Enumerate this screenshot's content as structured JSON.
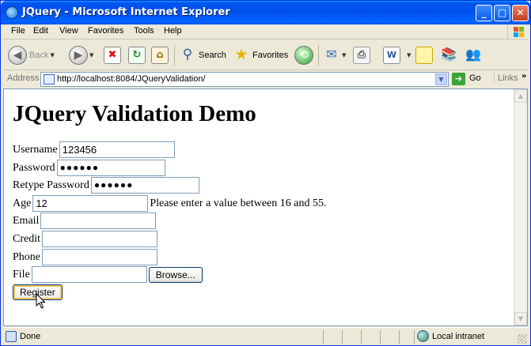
{
  "window": {
    "title": "JQuery - Microsoft Internet Explorer",
    "controls": {
      "minimize": "_",
      "maximize": "□",
      "close": "✕"
    }
  },
  "menu": {
    "items": [
      "File",
      "Edit",
      "View",
      "Favorites",
      "Tools",
      "Help"
    ]
  },
  "toolbar": {
    "back_label": "Back",
    "search_label": "Search",
    "favorites_label": "Favorites",
    "icons": [
      "back-icon",
      "forward-icon",
      "stop-icon",
      "refresh-icon",
      "home-icon",
      "search-icon",
      "favorites-star-icon",
      "history-icon",
      "mail-icon",
      "print-icon",
      "edit-icon",
      "discuss-icon",
      "research-icon",
      "messenger-icon"
    ]
  },
  "address": {
    "label": "Address",
    "url": "http://localhost:8084/JQueryValidation/",
    "go_label": "Go",
    "links_label": "Links"
  },
  "page": {
    "heading": "JQuery Validation Demo",
    "form": {
      "username": {
        "label": "Username",
        "value": "123456"
      },
      "password": {
        "label": "Password",
        "value": "●●●●●●"
      },
      "retype_password": {
        "label": "Retype Password",
        "value": "●●●●●●"
      },
      "age": {
        "label": "Age",
        "value": "12",
        "error": "Please enter a value between 16 and 55."
      },
      "email": {
        "label": "Email",
        "value": ""
      },
      "credit": {
        "label": "Credit",
        "value": ""
      },
      "phone": {
        "label": "Phone",
        "value": ""
      },
      "file": {
        "label": "File",
        "value": "",
        "browse_label": "Browse..."
      },
      "register_label": "Register"
    }
  },
  "status": {
    "text": "Done",
    "zone": "Local intranet"
  },
  "colors": {
    "titlebar": "#0054e3",
    "chrome": "#ece9d8",
    "field_border": "#7f9db9"
  }
}
